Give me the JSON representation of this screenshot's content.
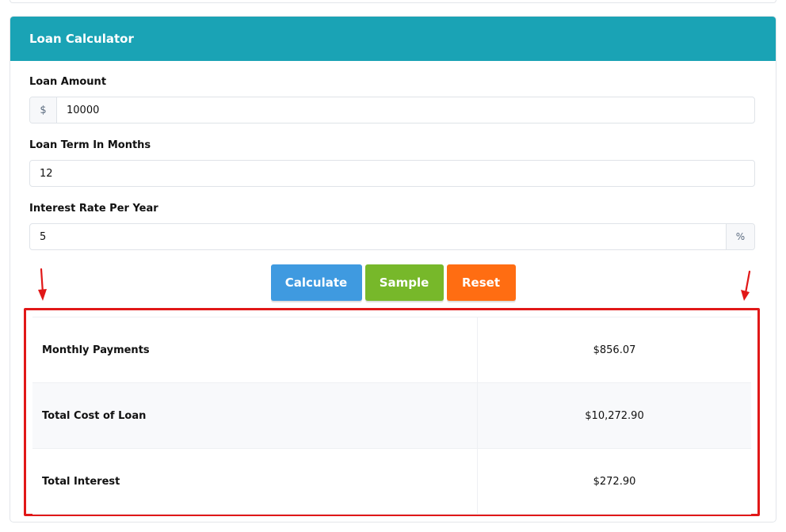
{
  "header": {
    "title": "Loan Calculator"
  },
  "form": {
    "loan_amount": {
      "label": "Loan Amount",
      "prefix": "$",
      "value": "10000"
    },
    "loan_term": {
      "label": "Loan Term In Months",
      "value": "12"
    },
    "interest_rate": {
      "label": "Interest Rate Per Year",
      "value": "5",
      "suffix": "%"
    }
  },
  "buttons": {
    "calculate": "Calculate",
    "sample": "Sample",
    "reset": "Reset"
  },
  "results": [
    {
      "label": "Monthly Payments",
      "value": "$856.07"
    },
    {
      "label": "Total Cost of Loan",
      "value": "$10,272.90"
    },
    {
      "label": "Total Interest",
      "value": "$272.90"
    }
  ],
  "colors": {
    "header": "#1aa3b5",
    "calculate": "#3f9ae0",
    "sample": "#77b82a",
    "reset": "#ff6d12",
    "highlight": "#e11818"
  },
  "icons": {
    "annotation": "red-arrow-icon"
  }
}
